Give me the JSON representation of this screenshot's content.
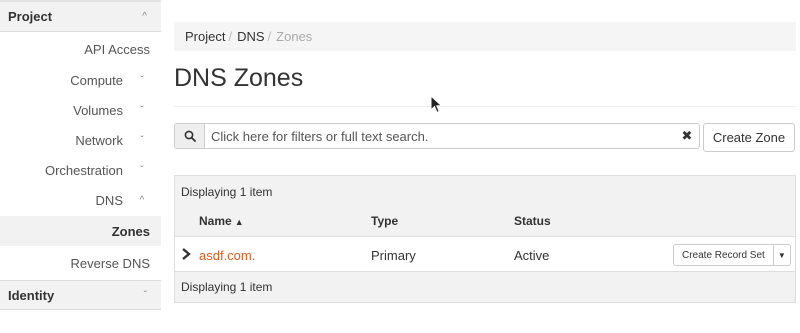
{
  "sidebar": {
    "sections": [
      {
        "label": "Project",
        "chevron": "^"
      },
      {
        "label": "Identity",
        "chevron": "ˇ"
      }
    ],
    "items": [
      {
        "label": "API Access",
        "chevron": ""
      },
      {
        "label": "Compute",
        "chevron": "ˇ"
      },
      {
        "label": "Volumes",
        "chevron": "ˇ"
      },
      {
        "label": "Network",
        "chevron": "ˇ"
      },
      {
        "label": "Orchestration",
        "chevron": "ˇ"
      },
      {
        "label": "DNS",
        "chevron": "^"
      },
      {
        "label": "Zones",
        "chevron": ""
      },
      {
        "label": "Reverse DNS",
        "chevron": ""
      }
    ]
  },
  "breadcrumb": {
    "items": [
      "Project",
      "DNS",
      "Zones"
    ],
    "separator": "/"
  },
  "page": {
    "title": "DNS Zones"
  },
  "search": {
    "placeholder": "Click here for filters or full text search.",
    "clear_glyph": "✖",
    "icon": "search-icon"
  },
  "toolbar": {
    "create_zone_label": "Create Zone"
  },
  "table": {
    "display_text_top": "Displaying 1 item",
    "display_text_bottom": "Displaying 1 item",
    "columns": [
      "Name",
      "Type",
      "Status"
    ],
    "sort_glyph": "▲",
    "rows": [
      {
        "name": "asdf.com.",
        "type": "Primary",
        "status": "Active",
        "action": "Create Record Set"
      }
    ]
  },
  "colors": {
    "link": "#e05a1b",
    "band": "#f2f2f2",
    "border": "#dddddd"
  }
}
